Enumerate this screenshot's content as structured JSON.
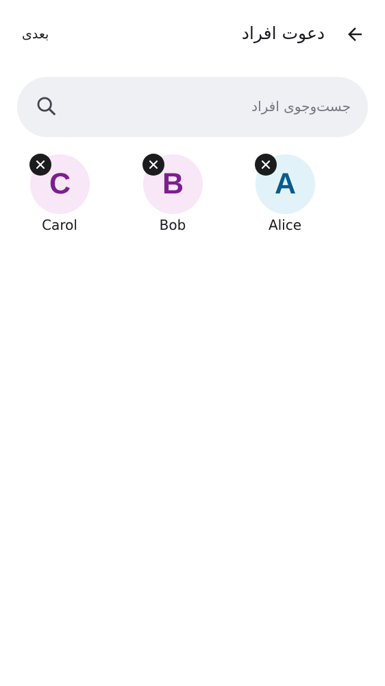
{
  "header": {
    "title": "دعوت افراد",
    "next_label": "بعدی",
    "back_icon": "arrow-back-icon"
  },
  "search": {
    "placeholder": "جست‌وجوی افراد",
    "value": "",
    "icon": "search-icon"
  },
  "selected_people": [
    {
      "name": "Alice",
      "initial": "A",
      "avatar_bg": "#e1f3f8",
      "avatar_fg": "#0c5a8c"
    },
    {
      "name": "Bob",
      "initial": "B",
      "avatar_bg": "#f8e7f6",
      "avatar_fg": "#7b1f8e"
    },
    {
      "name": "Carol",
      "initial": "C",
      "avatar_bg": "#f8e7f6",
      "avatar_fg": "#7b1f8e"
    }
  ],
  "colors": {
    "background": "#ffffff",
    "search_bg": "#eff0f4",
    "text": "#1b1b1f",
    "placeholder": "#75777f",
    "remove_badge": "#1c1c1e"
  }
}
